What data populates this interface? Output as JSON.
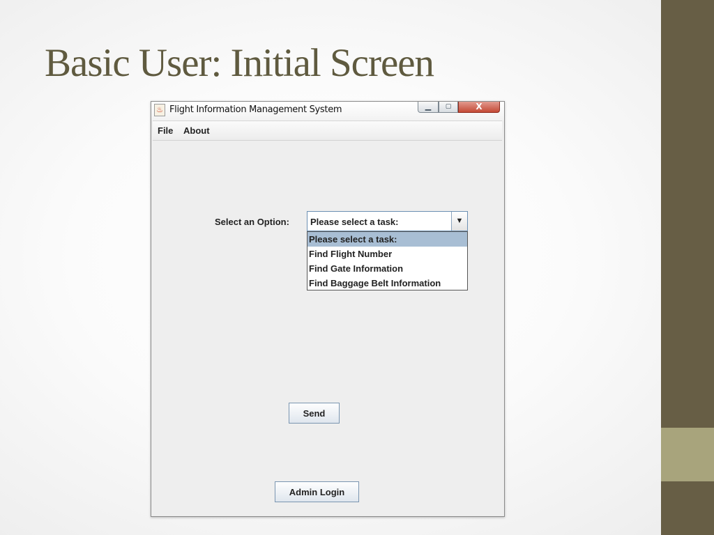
{
  "slide": {
    "title": "Basic User: Initial Screen"
  },
  "window": {
    "title": "Flight Information Management System",
    "icon": "java-coffee-icon",
    "controls": {
      "minimize": "▁",
      "maximize": "▢",
      "close": "X"
    }
  },
  "menu": {
    "items": [
      "File",
      "About"
    ]
  },
  "form": {
    "option_label": "Select an Option:",
    "combo_value": "Please select a task:",
    "combo_arrow": "▼",
    "options": [
      "Please select a task:",
      "Find Flight Number",
      "Find Gate Information",
      "Find Baggage Belt Information"
    ],
    "send_label": "Send",
    "admin_label": "Admin Login"
  },
  "colors": {
    "title_text": "#5f5a3f",
    "side_bar": "#675e45",
    "side_accent": "#a8a47c",
    "selection": "#a8bed4"
  }
}
